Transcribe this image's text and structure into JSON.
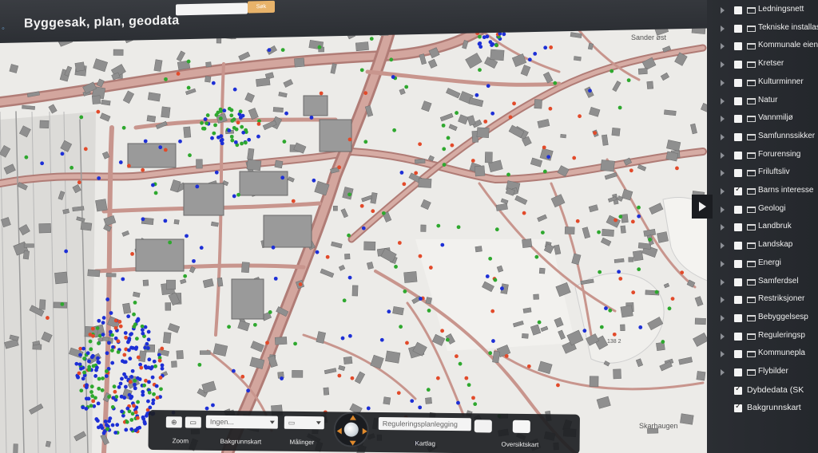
{
  "app": {
    "title": "Byggesak, plan, geodata",
    "search_button_label": "Søk"
  },
  "layers": [
    {
      "label": "Ledningsnett",
      "checked": false,
      "has_folder": true
    },
    {
      "label": "Tekniske installas",
      "checked": false,
      "has_folder": true
    },
    {
      "label": "Kommunale eiend",
      "checked": false,
      "has_folder": true
    },
    {
      "label": "Kretser",
      "checked": false,
      "has_folder": true
    },
    {
      "label": "Kulturminner",
      "checked": false,
      "has_folder": true
    },
    {
      "label": "Natur",
      "checked": false,
      "has_folder": true
    },
    {
      "label": "Vannmiljø",
      "checked": false,
      "has_folder": true
    },
    {
      "label": "Samfunnssikker",
      "checked": false,
      "has_folder": true
    },
    {
      "label": "Forurensing",
      "checked": false,
      "has_folder": true
    },
    {
      "label": "Friluftsliv",
      "checked": false,
      "has_folder": true
    },
    {
      "label": "Barns interesse",
      "checked": true,
      "has_folder": true
    },
    {
      "label": "Geologi",
      "checked": false,
      "has_folder": true
    },
    {
      "label": "Landbruk",
      "checked": false,
      "has_folder": true
    },
    {
      "label": "Landskap",
      "checked": false,
      "has_folder": true
    },
    {
      "label": "Energi",
      "checked": false,
      "has_folder": true
    },
    {
      "label": "Samferdsel",
      "checked": false,
      "has_folder": true
    },
    {
      "label": "Restriksjoner",
      "checked": false,
      "has_folder": true
    },
    {
      "label": "Bebyggelsesp",
      "checked": false,
      "has_folder": true
    },
    {
      "label": "Reguleringsp",
      "checked": false,
      "has_folder": true
    },
    {
      "label": "Kommunepla",
      "checked": false,
      "has_folder": true
    },
    {
      "label": "Flybilder",
      "checked": false,
      "has_folder": true
    },
    {
      "label": "Dybdedata (SK",
      "checked": true,
      "has_folder": false
    },
    {
      "label": "Bakgrunnskart",
      "checked": true,
      "has_folder": false
    }
  ],
  "map": {
    "place_labels": {
      "sander": "Sander øst",
      "skarhaugen": "Skarhaugen",
      "n138": "138 2"
    },
    "colors": {
      "background": "#ecebe8",
      "road": "#c99a92",
      "road_edge": "#b07c76",
      "building": "#8c8c8c",
      "blue": "#1d2fd6",
      "green": "#2ea82e",
      "red": "#e24a2a"
    }
  },
  "toolbar": {
    "zoom_label": "Zoom",
    "basemap_label": "Bakgrunnskart",
    "basemap_value": "Ingen...",
    "measure_label": "Målinger",
    "mapset_value": "Reguleringsplanlegging",
    "mapset_label": "Kartlag",
    "overview_label": "Oversiktskart",
    "zoom_in_icon": "magnifier-plus",
    "zoom_out_icon": "magnifier-minus",
    "pan_icon": "globe-pan"
  }
}
